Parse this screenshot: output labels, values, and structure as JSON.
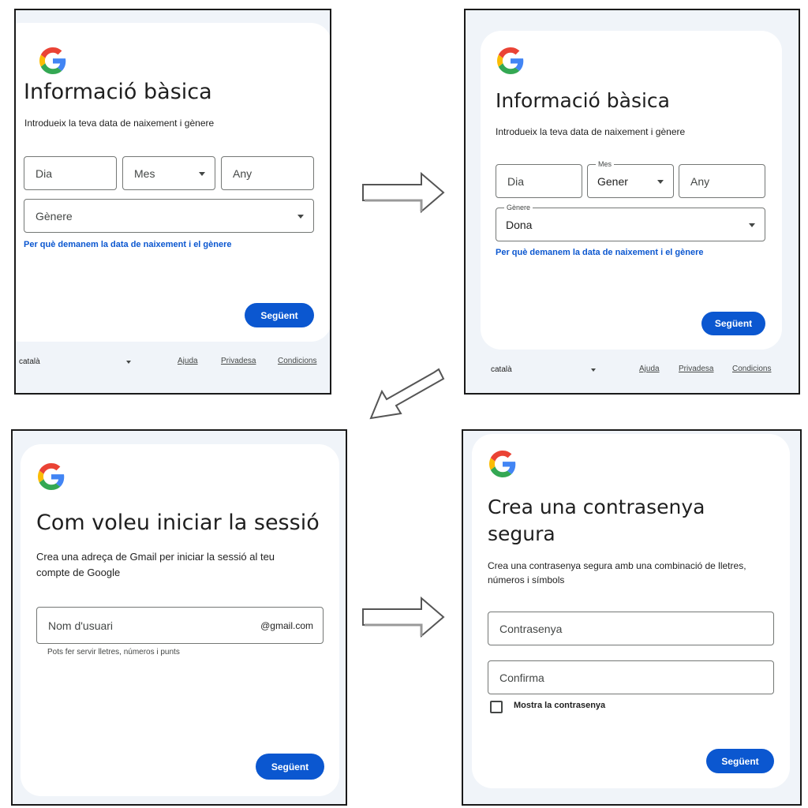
{
  "brand_colors": {
    "blue": "#4285F4",
    "red": "#EA4335",
    "yellow": "#FBBC05",
    "green": "#34A853",
    "button": "#0b57d0"
  },
  "panel1": {
    "logo_icon": "google-g-logo",
    "title": "Informació bàsica",
    "subtitle": "Introdueix la teva data de naixement i gènere",
    "day_placeholder": "Dia",
    "month_placeholder": "Mes",
    "year_placeholder": "Any",
    "gender_placeholder": "Gènere",
    "why_link": "Per què demanem la data de naixement i el gènere",
    "next_button": "Següent",
    "footer": {
      "language": "català",
      "help": "Ajuda",
      "privacy": "Privadesa",
      "terms": "Condicions"
    }
  },
  "panel2": {
    "logo_icon": "google-g-logo",
    "title": "Informació bàsica",
    "subtitle": "Introdueix la teva data de naixement i gènere",
    "day_placeholder": "Dia",
    "month_label": "Mes",
    "month_value": "Gener",
    "year_placeholder": "Any",
    "gender_label": "Gènere",
    "gender_value": "Dona",
    "why_link": "Per què demanem la data de naixement i el gènere",
    "next_button": "Següent",
    "footer": {
      "language": "català",
      "help": "Ajuda",
      "privacy": "Privadesa",
      "terms": "Condicions"
    }
  },
  "panel3": {
    "logo_icon": "google-g-logo",
    "title": "Com voleu iniciar la sessió",
    "subtitle": "Crea una adreça de Gmail per iniciar la sessió al teu compte de Google",
    "username_placeholder": "Nom d'usuari",
    "domain_suffix": "@gmail.com",
    "helper_text": "Pots fer servir lletres, números i punts",
    "next_button": "Següent"
  },
  "panel4": {
    "logo_icon": "google-g-logo",
    "title": "Crea una contrasenya segura",
    "subtitle": "Crea una contrasenya segura amb una combinació de lletres, números i símbols",
    "password_placeholder": "Contrasenya",
    "confirm_placeholder": "Confirma",
    "show_password_label": "Mostra la contrasenya",
    "next_button": "Següent"
  },
  "arrows": [
    "right-arrow",
    "down-left-arrow",
    "right-arrow"
  ]
}
